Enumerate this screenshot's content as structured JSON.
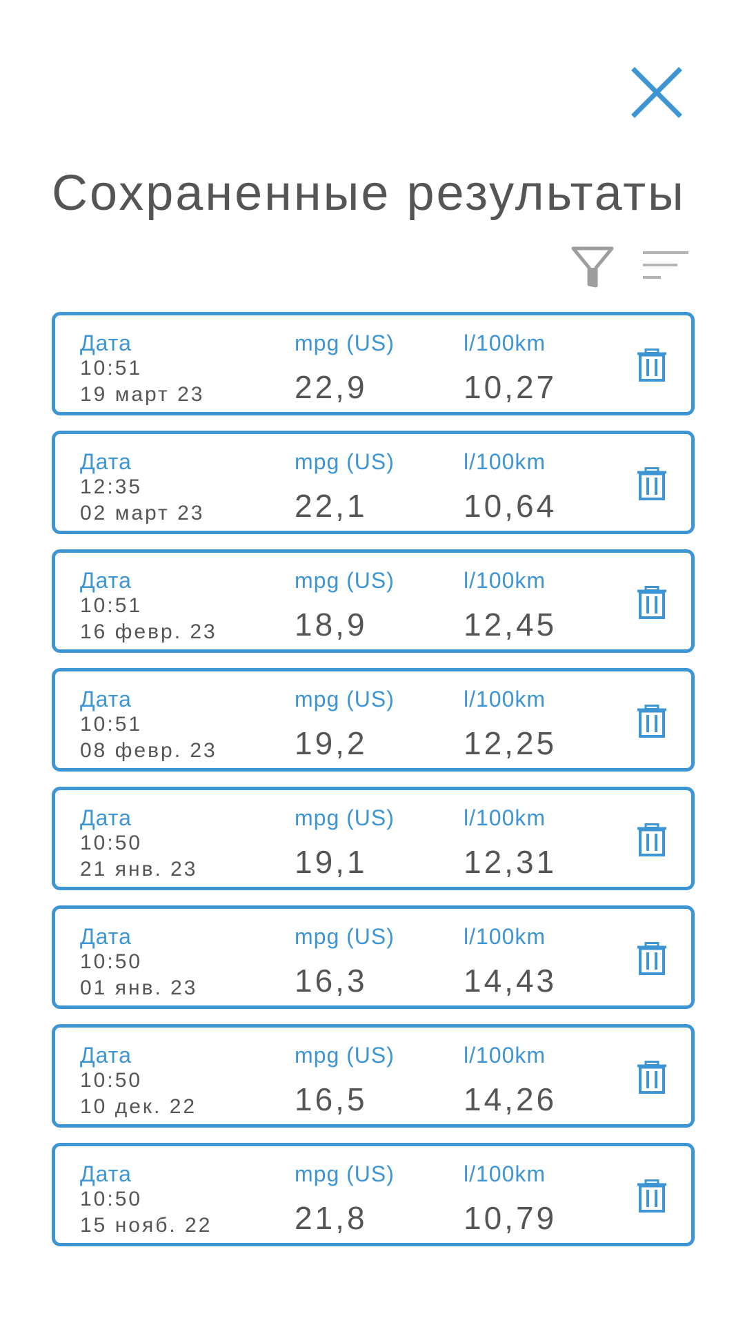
{
  "header": {
    "title": "Сохраненные результаты",
    "close_icon": "close-icon",
    "filter_icon": "filter-icon",
    "sort_icon": "sort-icon"
  },
  "colors": {
    "accent": "#3d95d3",
    "text": "#555555",
    "icon_gray": "#9e9e9e",
    "background": "#ffffff"
  },
  "results": [
    {
      "date_label": "Дата",
      "time": "10:51",
      "date": "19 март 23",
      "mpg_label": "mpg (US)",
      "mpg": "22,9",
      "l100_label": "l/100km",
      "l100": "10,27",
      "delete_icon": "trash-icon"
    },
    {
      "date_label": "Дата",
      "time": "12:35",
      "date": "02 март 23",
      "mpg_label": "mpg (US)",
      "mpg": "22,1",
      "l100_label": "l/100km",
      "l100": "10,64",
      "delete_icon": "trash-icon"
    },
    {
      "date_label": "Дата",
      "time": "10:51",
      "date": "16 февр. 23",
      "mpg_label": "mpg (US)",
      "mpg": "18,9",
      "l100_label": "l/100km",
      "l100": "12,45",
      "delete_icon": "trash-icon"
    },
    {
      "date_label": "Дата",
      "time": "10:51",
      "date": "08 февр. 23",
      "mpg_label": "mpg (US)",
      "mpg": "19,2",
      "l100_label": "l/100km",
      "l100": "12,25",
      "delete_icon": "trash-icon"
    },
    {
      "date_label": "Дата",
      "time": "10:50",
      "date": "21 янв. 23",
      "mpg_label": "mpg (US)",
      "mpg": "19,1",
      "l100_label": "l/100km",
      "l100": "12,31",
      "delete_icon": "trash-icon"
    },
    {
      "date_label": "Дата",
      "time": "10:50",
      "date": "01 янв. 23",
      "mpg_label": "mpg (US)",
      "mpg": "16,3",
      "l100_label": "l/100km",
      "l100": "14,43",
      "delete_icon": "trash-icon"
    },
    {
      "date_label": "Дата",
      "time": "10:50",
      "date": "10 дек. 22",
      "mpg_label": "mpg (US)",
      "mpg": "16,5",
      "l100_label": "l/100km",
      "l100": "14,26",
      "delete_icon": "trash-icon"
    },
    {
      "date_label": "Дата",
      "time": "10:50",
      "date": "15 нояб. 22",
      "mpg_label": "mpg (US)",
      "mpg": "21,8",
      "l100_label": "l/100km",
      "l100": "10,79",
      "delete_icon": "trash-icon"
    }
  ]
}
